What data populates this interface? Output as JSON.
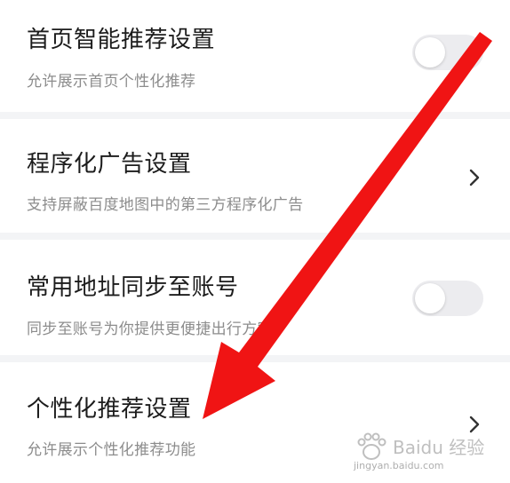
{
  "settings": [
    {
      "title": "首页智能推荐设置",
      "description": "允许展示首页个性化推荐",
      "control": "toggle",
      "toggle_on": false
    },
    {
      "title": "程序化广告设置",
      "description": "支持屏蔽百度地图中的第三方程序化广告",
      "control": "chevron"
    },
    {
      "title": "常用地址同步至账号",
      "description": "同步至账号为你提供更便捷出行方案",
      "control": "toggle",
      "toggle_on": false
    },
    {
      "title": "个性化推荐设置",
      "description": "允许展示个性化推荐功能",
      "control": "chevron"
    }
  ],
  "annotation": {
    "arrow_color": "#f01414",
    "points_to": "个性化推荐设置"
  },
  "watermark": {
    "brand": "Baidu 经验",
    "url": "jingyan.baidu.com"
  },
  "colors": {
    "title": "#1c1c1c",
    "description": "#8c8c8c",
    "toggle_off": "#ececef",
    "background": "#f3f4f6"
  }
}
